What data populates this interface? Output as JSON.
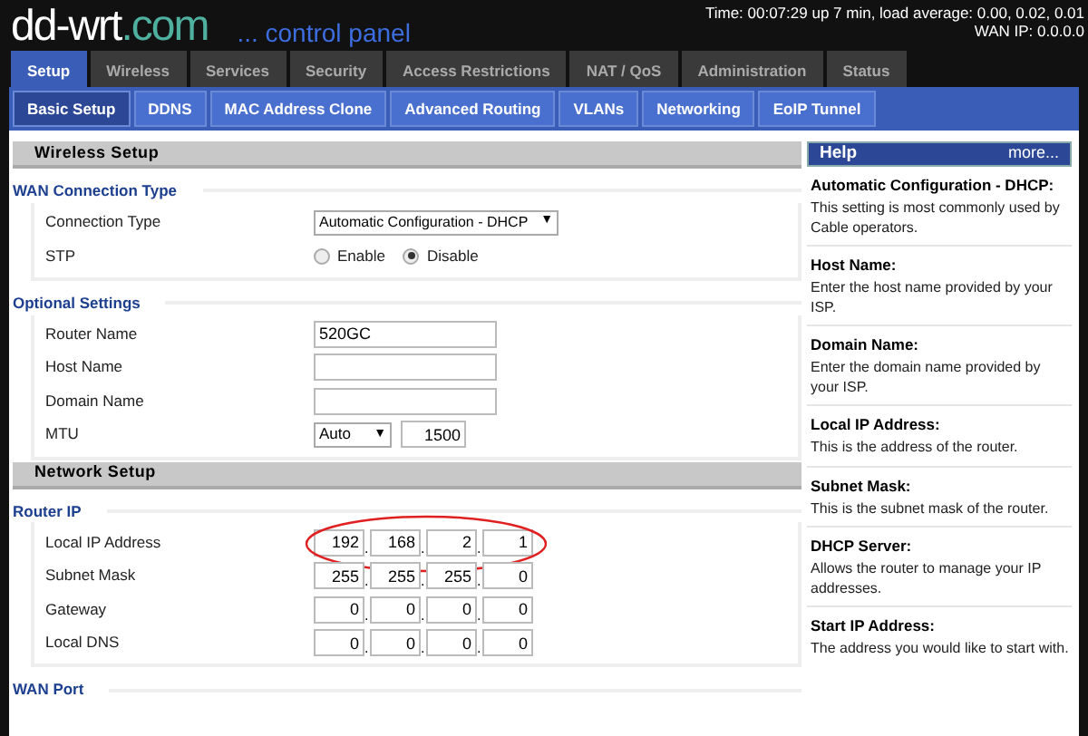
{
  "header": {
    "status_lines": [
      "Time: 00:07:29 up 7 min, load average: 0.00, 0.02, 0.01",
      "WAN IP: 0.0.0.0"
    ],
    "logo": {
      "name": "dd-wrt",
      "suffix": ".com"
    },
    "subtitle": "... control panel"
  },
  "tabs": [
    {
      "label": "Setup",
      "selected": true
    },
    {
      "label": "Wireless",
      "selected": false
    },
    {
      "label": "Services",
      "selected": false
    },
    {
      "label": "Security",
      "selected": false
    },
    {
      "label": "Access Restrictions",
      "selected": false
    },
    {
      "label": "NAT / QoS",
      "selected": false
    },
    {
      "label": "Administration",
      "selected": false
    },
    {
      "label": "Status",
      "selected": false
    }
  ],
  "subtabs": [
    {
      "label": "Basic Setup",
      "selected": true
    },
    {
      "label": "DDNS",
      "selected": false
    },
    {
      "label": "MAC Address Clone",
      "selected": false
    },
    {
      "label": "Advanced Routing",
      "selected": false
    },
    {
      "label": "VLANs",
      "selected": false
    },
    {
      "label": "Networking",
      "selected": false
    },
    {
      "label": "EoIP Tunnel",
      "selected": false
    }
  ],
  "sections": [
    {
      "title": "Wireless Setup",
      "groups": [
        {
          "legend": "WAN Connection Type",
          "rows": [
            {
              "kind": "select",
              "label": "Connection Type",
              "value": "Automatic Configuration - DHCP",
              "arrow": "▼"
            },
            {
              "kind": "radio",
              "label": "STP",
              "options": [
                {
                  "label": "Enable",
                  "selected": false
                },
                {
                  "label": "Disable",
                  "selected": true
                }
              ]
            }
          ]
        },
        {
          "legend": "Optional Settings",
          "rows": [
            {
              "kind": "text",
              "label": "Router Name",
              "value": "520GC"
            },
            {
              "kind": "text",
              "label": "Host Name"
            },
            {
              "kind": "text",
              "label": "Domain Name"
            },
            {
              "kind": "mtu",
              "label": "MTU",
              "value": "Auto",
              "arrow": "▼",
              "size": "1500"
            }
          ]
        }
      ]
    },
    {
      "title": "Network Setup",
      "groups": [
        {
          "legend": "Router IP",
          "rows": [
            {
              "kind": "ip",
              "label": "Local IP Address",
              "octets": [
                "192",
                "168",
                "2",
                "1"
              ],
              "separator": ".",
              "circled": true
            },
            {
              "kind": "ip",
              "label": "Subnet Mask",
              "octets": [
                "255",
                "255",
                "255",
                "0"
              ],
              "separator": ".",
              "circled": false
            },
            {
              "kind": "ip",
              "label": "Gateway",
              "octets": [
                "0",
                "0",
                "0",
                "0"
              ],
              "separator": ".",
              "circled": false
            },
            {
              "kind": "ip",
              "label": "Local DNS",
              "octets": [
                "0",
                "0",
                "0",
                "0"
              ],
              "separator": ".",
              "circled": false
            }
          ]
        },
        {
          "legend": "WAN Port"
        }
      ]
    }
  ],
  "help": {
    "title": "Help",
    "more": "more...",
    "entries": [
      {
        "title": "Automatic Configuration - DHCP:",
        "text": "This setting is most commonly used by Cable operators."
      },
      {
        "title": "Host Name:",
        "text": "Enter the host name provided by your ISP."
      },
      {
        "title": "Domain Name:",
        "text": "Enter the domain name provided by your ISP."
      },
      {
        "title": "Local IP Address:",
        "text": "This is the address of the router."
      },
      {
        "title": "Subnet Mask:",
        "text": "This is the subnet mask of the router."
      },
      {
        "title": "DHCP Server:",
        "text": "Allows the router to manage your IP addresses."
      },
      {
        "title": "Start IP Address:",
        "text": "The address you would like to start with."
      }
    ]
  }
}
